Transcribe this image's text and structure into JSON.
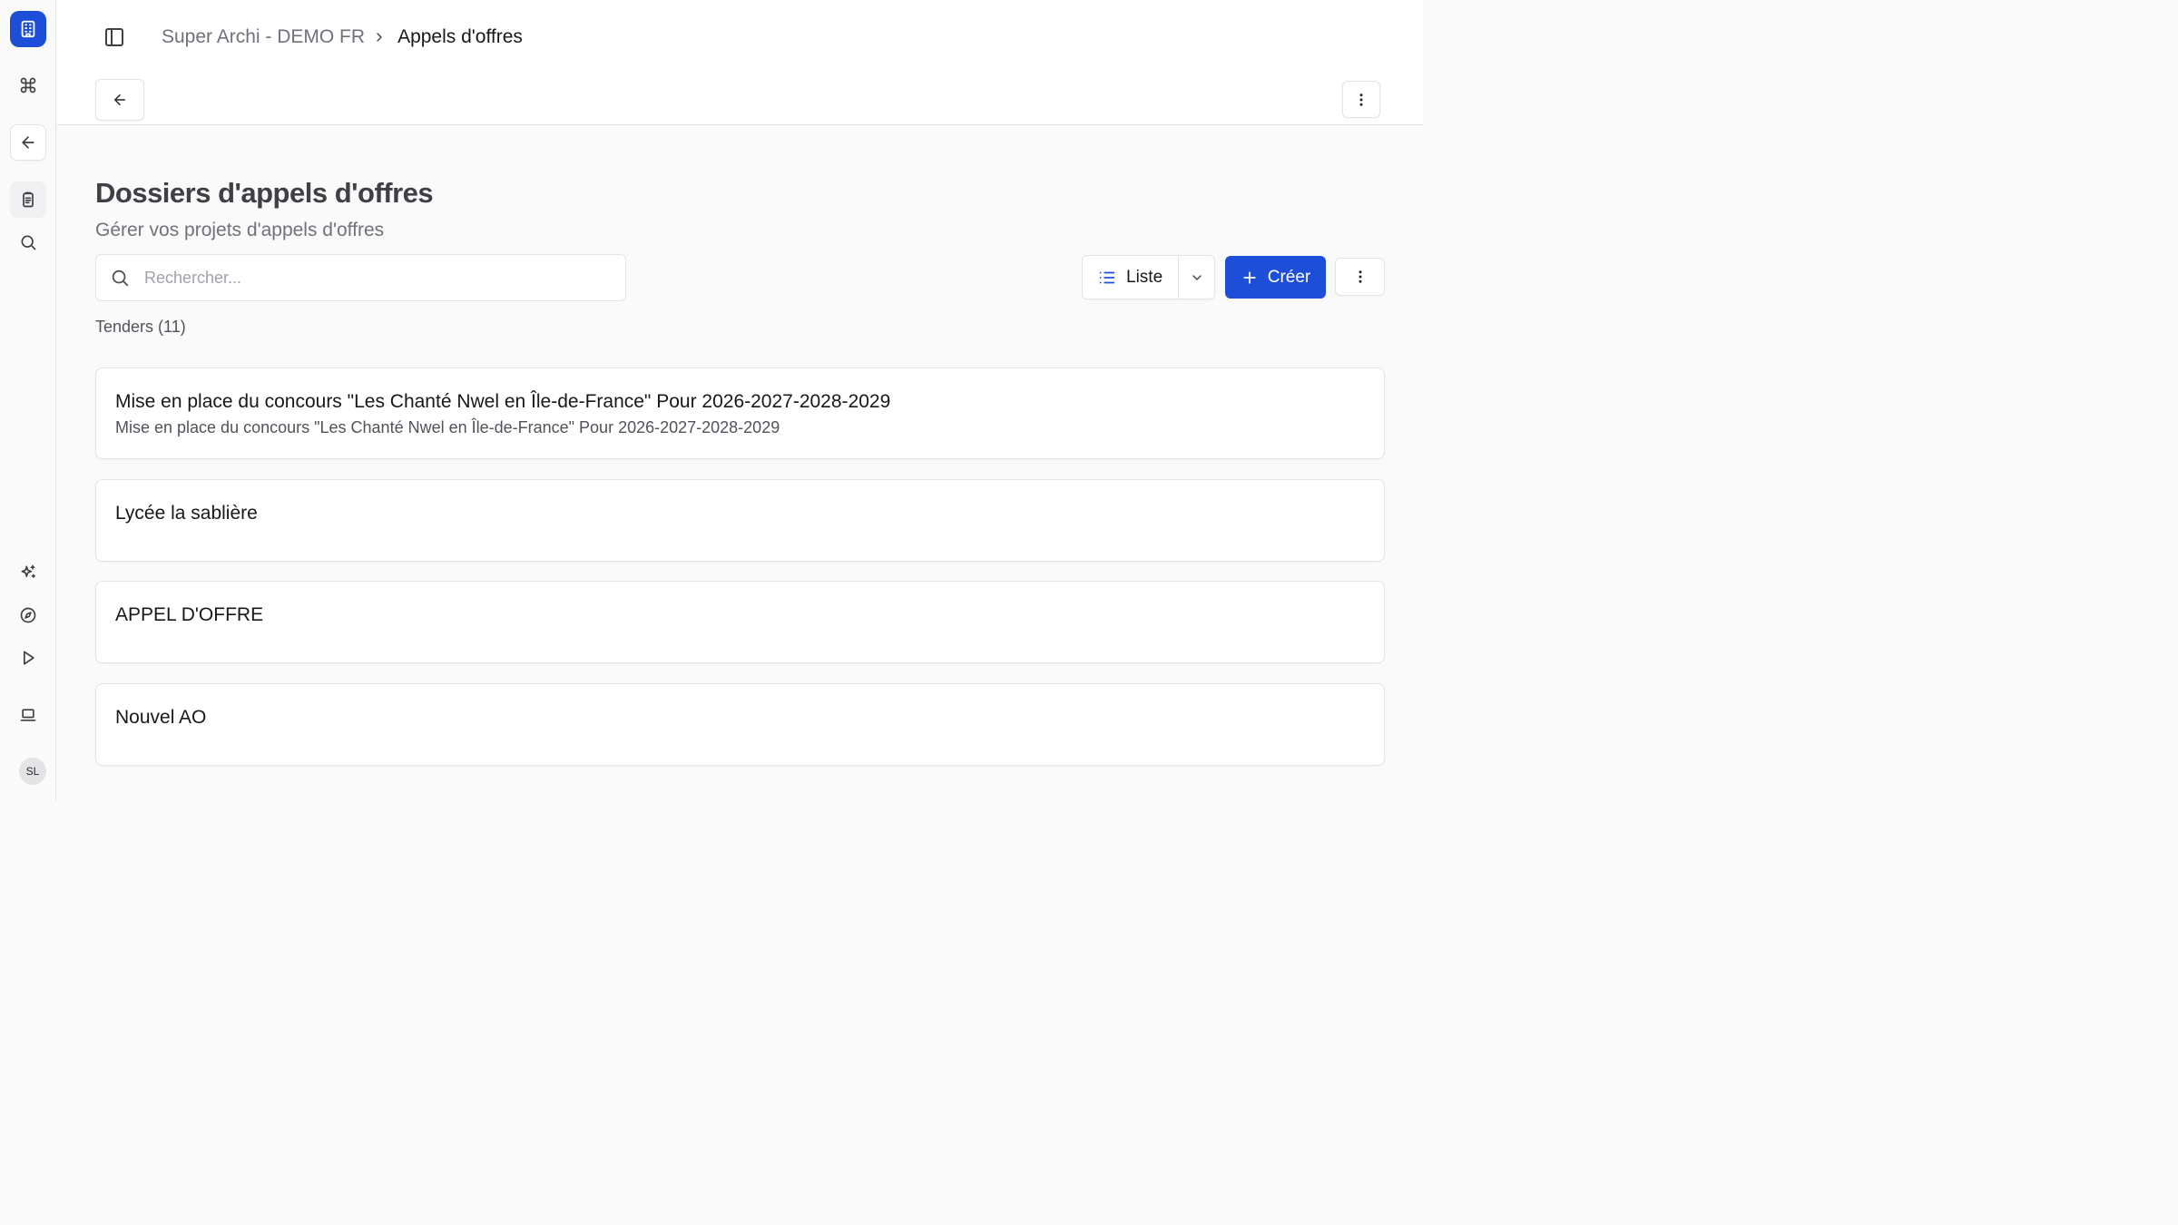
{
  "sidebar": {
    "items": [
      {
        "name": "logo",
        "icon": "building-icon"
      },
      {
        "name": "command",
        "icon": "command-icon"
      },
      {
        "name": "back",
        "icon": "arrow-left-icon"
      },
      {
        "name": "tenders",
        "icon": "clipboard-icon"
      },
      {
        "name": "search",
        "icon": "search-icon"
      },
      {
        "name": "ai",
        "icon": "sparkles-icon"
      },
      {
        "name": "explore",
        "icon": "compass-icon"
      },
      {
        "name": "play",
        "icon": "play-icon"
      },
      {
        "name": "device",
        "icon": "laptop-icon"
      }
    ],
    "avatar_initials": "SL"
  },
  "header": {
    "breadcrumb": {
      "parent": "Super Archi - DEMO FR",
      "current": "Appels d'offres"
    }
  },
  "main": {
    "title": "Dossiers d'appels d'offres",
    "subtitle": "Gérer vos projets d'appels d'offres",
    "search_placeholder": "Rechercher...",
    "view_label": "Liste",
    "create_label": "Créer",
    "count_label": "Tenders (11)",
    "tenders": [
      {
        "title": "Mise en place du concours \"Les Chanté Nwel en Île-de-France\" Pour 2026-2027-2028-2029",
        "description": "Mise en place du concours \"Les Chanté Nwel en Île-de-France\" Pour 2026-2027-2028-2029"
      },
      {
        "title": "Lycée la sablière",
        "description": ""
      },
      {
        "title": "APPEL D'OFFRE",
        "description": ""
      },
      {
        "title": "Nouvel AO",
        "description": ""
      }
    ]
  },
  "colors": {
    "accent": "#1d4ed8",
    "border": "#e4e4e7",
    "background": "#fafafa"
  }
}
